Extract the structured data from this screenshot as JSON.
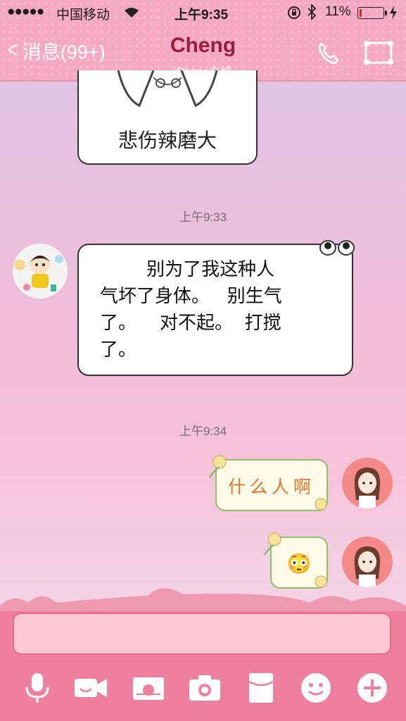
{
  "status_bar": {
    "signal": "●●●●●",
    "carrier": "中国移动",
    "time": "上午9:35",
    "battery_percent": "11%",
    "battery_level": 0.11
  },
  "header": {
    "back_label": "消息(99+)",
    "title": "Cheng",
    "subtitle": "iPhone在线",
    "icons": [
      "phone-icon",
      "profile-icon"
    ]
  },
  "messages": [
    {
      "type": "sticker",
      "from": "contact",
      "caption": "悲伤辣磨大"
    },
    {
      "type": "timestamp",
      "text": "上午9:33"
    },
    {
      "type": "text",
      "from": "contact",
      "text": "        别为了我这种人\n气坏了身体。   别生气\n了。    对不起。  打搅\n了。"
    },
    {
      "type": "timestamp",
      "text": "上午9:34"
    },
    {
      "type": "text",
      "from": "me",
      "text": "什么人啊"
    },
    {
      "type": "emoji",
      "from": "me",
      "emoji": "😳"
    }
  ],
  "toolbar": {
    "icons": [
      "microphone-icon",
      "video-icon",
      "image-icon",
      "camera-icon",
      "red-packet-icon",
      "emoji-icon",
      "plus-icon"
    ]
  },
  "colors": {
    "header_bg": "#f6a9c2",
    "title": "#9b1d3d",
    "bottom_bar": "#ef7f9f",
    "outgoing_border": "#8cc36a",
    "outgoing_text": "#e0762a"
  }
}
